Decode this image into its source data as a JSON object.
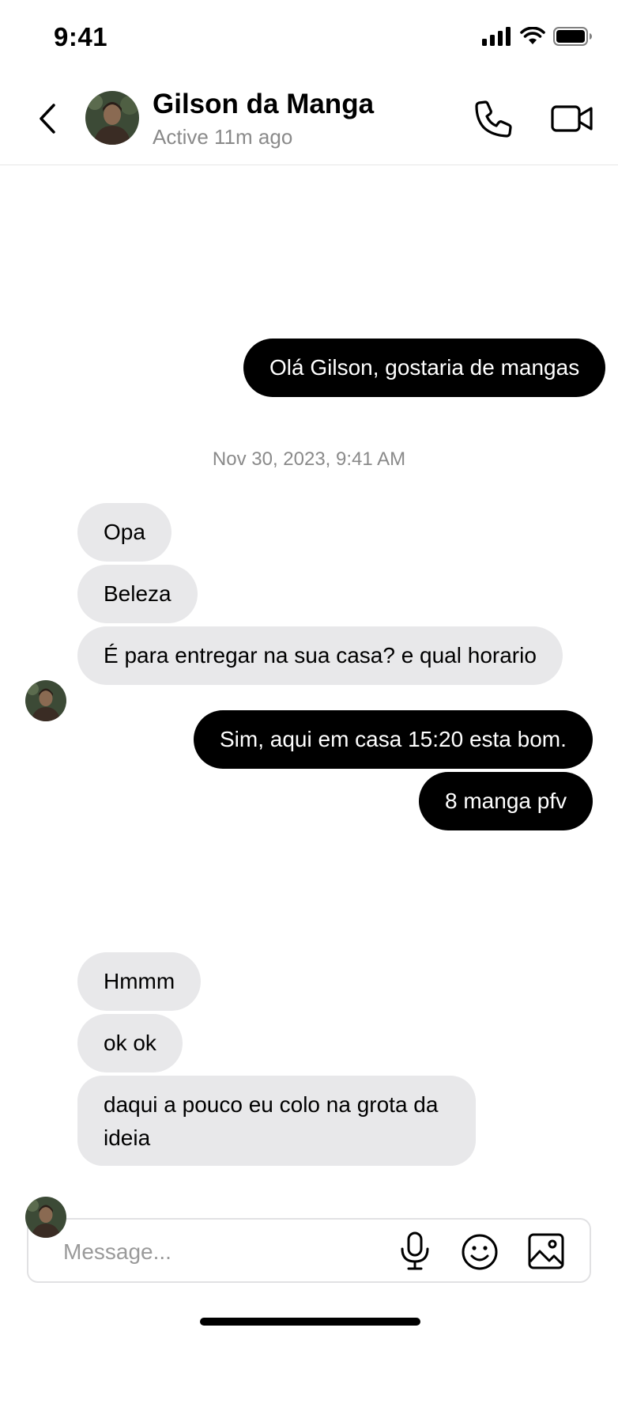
{
  "status_bar": {
    "time": "9:41"
  },
  "header": {
    "contact_name": "Gilson da Manga",
    "contact_status": "Active 11m ago"
  },
  "messages": [
    {
      "text": "Olá Gilson, gostaria de mangas",
      "direction": "outgoing"
    },
    {
      "text": "Opa",
      "direction": "incoming"
    },
    {
      "text": "Beleza",
      "direction": "incoming"
    },
    {
      "text": "É para entregar na sua casa? e qual horario",
      "direction": "incoming"
    },
    {
      "text": "Sim, aqui em casa 15:20 esta bom.",
      "direction": "outgoing"
    },
    {
      "text": "8 manga pfv",
      "direction": "outgoing"
    },
    {
      "text": "Hmmm",
      "direction": "incoming"
    },
    {
      "text": "ok ok",
      "direction": "incoming"
    },
    {
      "text": "daqui a pouco eu colo na grota da ideia",
      "direction": "incoming"
    }
  ],
  "timestamp": "Nov 30, 2023, 9:41 AM",
  "composer": {
    "placeholder": "Message..."
  },
  "colors": {
    "outgoing_bubble": "#000000",
    "incoming_bubble": "#e8e8ea",
    "secondary_text": "#8a8a8a"
  },
  "icons": [
    "chevron-left-icon",
    "phone-icon",
    "video-camera-icon",
    "microphone-icon",
    "smiley-icon",
    "image-icon",
    "signal-icon",
    "wifi-icon",
    "battery-icon"
  ]
}
